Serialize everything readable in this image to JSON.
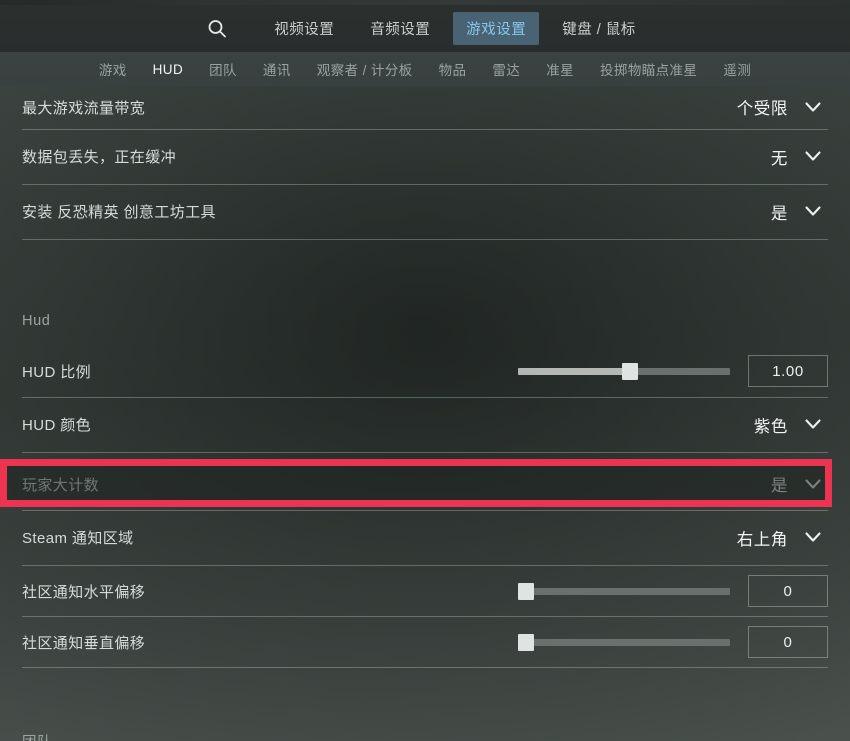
{
  "header": {
    "search_icon": "search-icon",
    "main_tabs": [
      {
        "label": "视频设置",
        "active": false
      },
      {
        "label": "音频设置",
        "active": false
      },
      {
        "label": "游戏设置",
        "active": true
      },
      {
        "label": "键盘 / 鼠标",
        "active": false
      }
    ],
    "sub_tabs": [
      {
        "label": "游戏",
        "active": false
      },
      {
        "label": "HUD",
        "active": true
      },
      {
        "label": "团队",
        "active": false
      },
      {
        "label": "通讯",
        "active": false
      },
      {
        "label": "观察者 / 计分板",
        "active": false
      },
      {
        "label": "物品",
        "active": false
      },
      {
        "label": "雷达",
        "active": false
      },
      {
        "label": "准星",
        "active": false
      },
      {
        "label": "投掷物瞄点准星",
        "active": false
      },
      {
        "label": "遥测",
        "active": false
      }
    ]
  },
  "settings": {
    "rows": [
      {
        "label": "最大游戏流量带宽",
        "value": "个受限",
        "control": "dropdown"
      },
      {
        "label": "数据包丢失，正在缓冲",
        "value": "无",
        "control": "dropdown"
      },
      {
        "label": "安装 反恐精英 创意工坊工具",
        "value": "是",
        "control": "dropdown"
      }
    ],
    "hud_section_title": "Hud",
    "hud_rows": [
      {
        "label": "HUD 比例",
        "value": "1.00",
        "control": "slider",
        "fill_percent": 52
      },
      {
        "label": "HUD 颜色",
        "value": "紫色",
        "control": "dropdown"
      },
      {
        "label": "玩家大计数",
        "value": "是",
        "control": "dropdown",
        "highlighted": true
      },
      {
        "label": "Steam 通知区域",
        "value": "右上角",
        "control": "dropdown"
      },
      {
        "label": "社区通知水平偏移",
        "value": "0",
        "control": "slider",
        "fill_percent": 3
      },
      {
        "label": "社区通知垂直偏移",
        "value": "0",
        "control": "slider",
        "fill_percent": 3
      }
    ],
    "next_section_title": "团队"
  },
  "colors": {
    "highlight_red": "#ec3450",
    "active_tab_bg": "#4a6374",
    "active_tab_text": "#86c8ec"
  }
}
